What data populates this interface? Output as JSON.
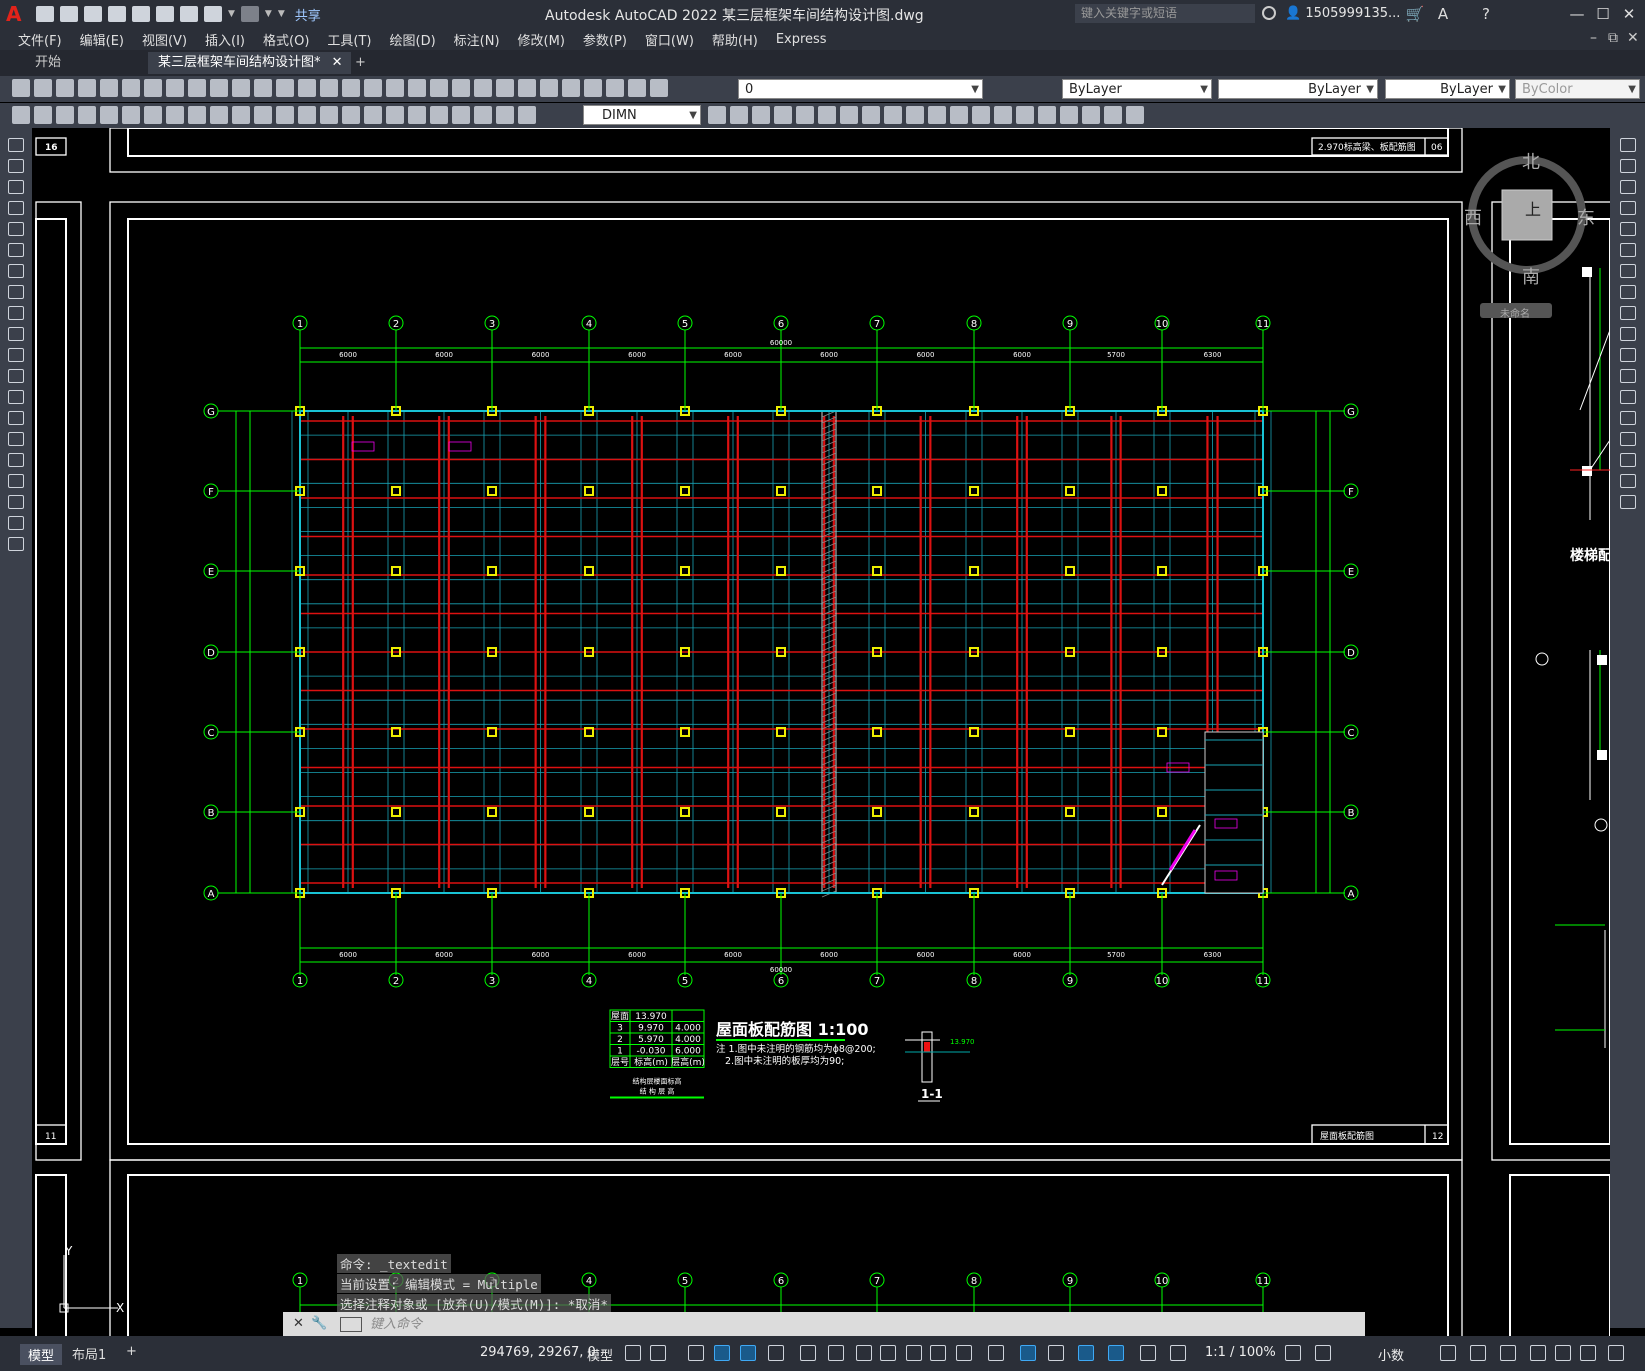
{
  "titlebar": {
    "app_logo": "A",
    "share_label": "共享",
    "window_title": "Autodesk AutoCAD 2022    某三层框架车间结构设计图.dwg",
    "search_placeholder": "键入关键字或短语",
    "user_name": "1505999135..."
  },
  "menubar": {
    "items": [
      "文件(F)",
      "编辑(E)",
      "视图(V)",
      "插入(I)",
      "格式(O)",
      "工具(T)",
      "绘图(D)",
      "标注(N)",
      "修改(M)",
      "参数(P)",
      "窗口(W)",
      "帮助(H)",
      "Express"
    ]
  },
  "tabs": {
    "start": "开始",
    "active": "某三层框架车间结构设计图*"
  },
  "layers": {
    "current_layer": "0",
    "color": "ByLayer",
    "linetype": "ByLayer",
    "lineweight": "ByLayer",
    "plotstyle": "ByColor",
    "dimstyle": "DIMN"
  },
  "viewcube": {
    "north": "北",
    "south": "南",
    "east": "东",
    "west": "西",
    "top": "上",
    "wcs": "未命名"
  },
  "drawing": {
    "title": "屋面板配筋图  1:100",
    "note1": "注 1.图中未注明的钢筋均为ϕ8@200;",
    "note2": "2.图中未注明的板厚均为90;",
    "section_label": "1-1",
    "sheet_no": "12",
    "prev_sheet_no": "11",
    "top_sheet_no": "06",
    "top_sheet_title": "2.970标高梁、板配筋图",
    "sheet_title": "屋面板配筋图",
    "staircase_title": "楼梯配",
    "total_dim": "60000",
    "col_axes": [
      "1",
      "2",
      "3",
      "4",
      "5",
      "6",
      "7",
      "8",
      "9",
      "10",
      "11"
    ],
    "row_axes": [
      "G",
      "F",
      "E",
      "D",
      "C",
      "B",
      "A"
    ],
    "top_spans": [
      "6000",
      "6000",
      "6000",
      "6000",
      "6000",
      "6000",
      "6000",
      "6000",
      "5700",
      "6300"
    ],
    "bottom_spans": [
      "6000",
      "6000",
      "6000",
      "6000",
      "6000",
      "6000",
      "6000",
      "6000",
      "5700",
      "6300"
    ],
    "elev_table": [
      [
        "屋面",
        "13.970",
        ""
      ],
      [
        "3",
        "9.970",
        "4.000"
      ],
      [
        "2",
        "5.970",
        "4.000"
      ],
      [
        "1",
        "-0.030",
        "6.000"
      ],
      [
        "层号",
        "标高(m)",
        "层高(m)"
      ]
    ],
    "elev_table_title": "结构层楼面标高",
    "elev_table_sub": "结 构 层 高",
    "section_elev": "13.970"
  },
  "command": {
    "history": [
      "命令: _textedit",
      "当前设置: 编辑模式 = Multiple",
      "选择注释对象或 [放弃(U)/模式(M)]: *取消*"
    ],
    "prompt_placeholder": "键入命令"
  },
  "status": {
    "tab_model": "模型",
    "tab_layout": "布局1",
    "coords": "294769, 29267, 0",
    "model_label": "模型",
    "scale": "1:1 / 100%",
    "units": "小数"
  }
}
